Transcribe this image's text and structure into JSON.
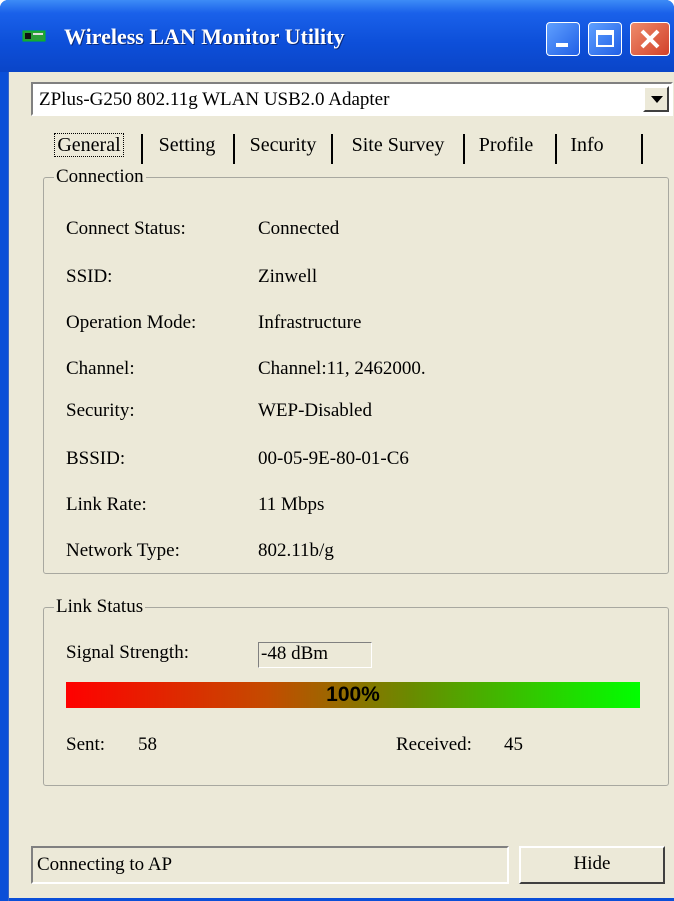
{
  "window": {
    "title": "Wireless LAN Monitor Utility"
  },
  "adapter": {
    "selected": "ZPlus-G250 802.11g WLAN USB2.0 Adapter"
  },
  "tabs": [
    {
      "label": "General"
    },
    {
      "label": "Setting"
    },
    {
      "label": "Security"
    },
    {
      "label": "Site Survey"
    },
    {
      "label": "Profile"
    },
    {
      "label": "Info"
    }
  ],
  "connection": {
    "legend": "Connection",
    "rows": [
      {
        "label": "Connect Status:",
        "value": "Connected"
      },
      {
        "label": "SSID:",
        "value": "Zinwell"
      },
      {
        "label": "Operation Mode:",
        "value": "Infrastructure"
      },
      {
        "label": "Channel:",
        "value": "Channel:11, 2462000."
      },
      {
        "label": "Security:",
        "value": "WEP-Disabled"
      },
      {
        "label": "BSSID:",
        "value": "00-05-9E-80-01-C6"
      },
      {
        "label": "Link Rate:",
        "value": "11 Mbps"
      },
      {
        "label": "Network Type:",
        "value": "802.11b/g"
      }
    ]
  },
  "link_status": {
    "legend": "Link Status",
    "signal_label": "Signal Strength:",
    "signal_value": "-48 dBm",
    "quality_text": "100%",
    "quality_fraction": 1.0,
    "sent_label": "Sent:",
    "sent_value": "58",
    "received_label": "Received:",
    "received_value": "45"
  },
  "status_bar": {
    "text": "Connecting to AP"
  },
  "hide_button": {
    "label": "Hide"
  },
  "colors": {
    "titlebar": "#0b4fd8",
    "dialog": "#ece9d8",
    "bar_start": "#ff0000",
    "bar_end": "#00ff00"
  }
}
